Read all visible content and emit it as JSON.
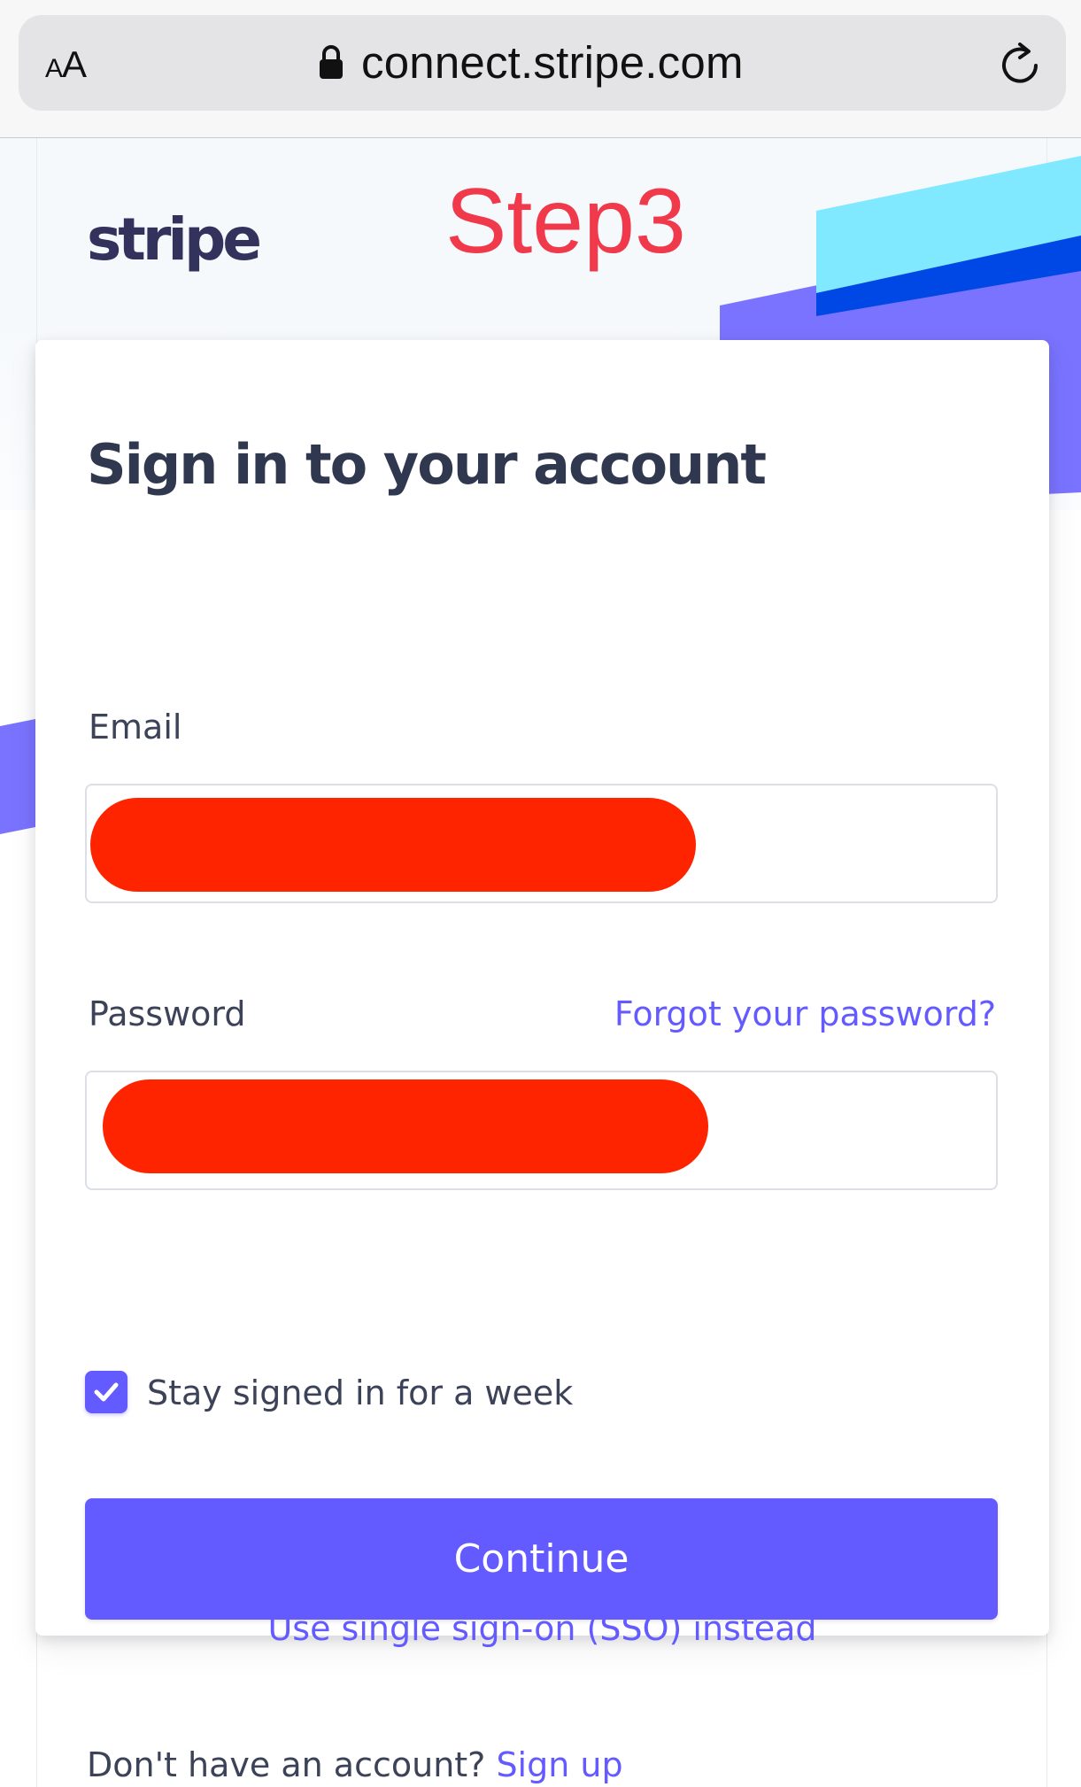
{
  "browser": {
    "text_size_small": "A",
    "text_size_large": "A",
    "url": "connect.stripe.com",
    "icons": [
      "lock-icon",
      "reload-icon"
    ]
  },
  "header": {
    "logo_text": "stripe",
    "annotation": "Step3"
  },
  "signin": {
    "title": "Sign in to your account",
    "email_label": "Email",
    "password_label": "Password",
    "forgot_password": "Forgot your password?",
    "email_value_redacted": true,
    "password_value_redacted": true,
    "stay_signed_in_checked": true,
    "stay_signed_in_label": "Stay signed in for a week",
    "continue_label": "Continue",
    "sso_link": "Use single sign-on (SSO) instead"
  },
  "footer": {
    "no_account_text": "Don't have an account?",
    "signup_link": "Sign up"
  },
  "colors": {
    "accent": "#635bff",
    "heading": "#303850",
    "text": "#3c4257",
    "redaction": "#ff2400",
    "annotation": "#f0394b",
    "decor_cyan": "#80e9ff",
    "decor_blue": "#0048e5",
    "decor_purple": "#7a73ff"
  }
}
